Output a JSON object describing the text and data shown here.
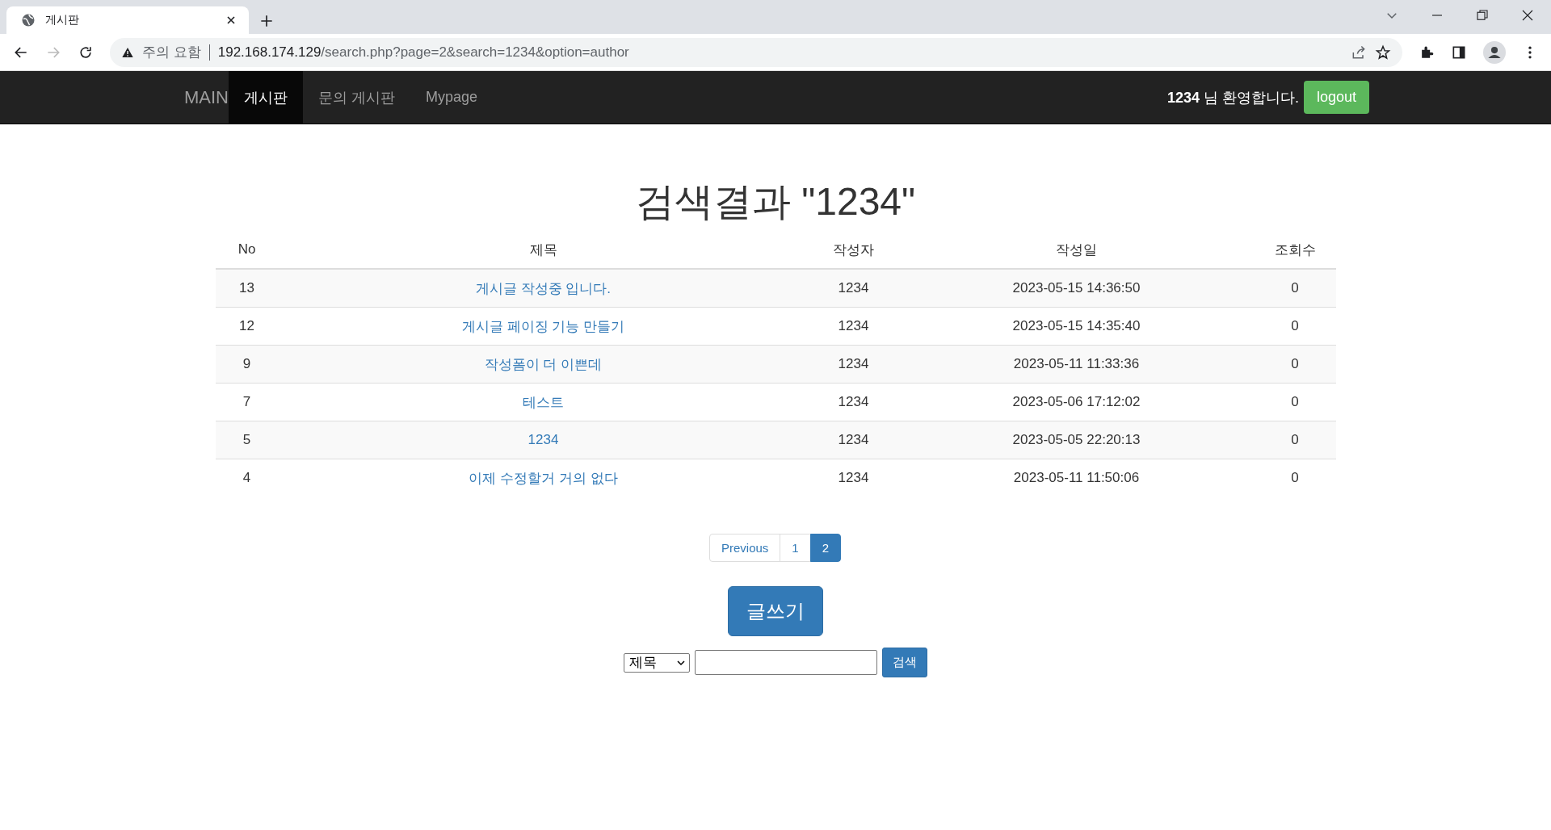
{
  "browser": {
    "tab_title": "게시판",
    "security_label": "주의 요함",
    "url_host": "192.168.174.129",
    "url_path": "/search.php?page=2&search=1234&option=author"
  },
  "navbar": {
    "brand": "MAIN",
    "items": [
      {
        "label": "게시판",
        "selected": true
      },
      {
        "label": "문의 게시판",
        "selected": false
      },
      {
        "label": "Mypage",
        "selected": false
      }
    ],
    "welcome": "**1234** 님 환영합니다.",
    "logout": "logout"
  },
  "title": "검색결과 \"1234\"",
  "table": {
    "columns": [
      "No",
      "제목",
      "작성자",
      "작성일",
      "조회수"
    ],
    "rows": [
      [
        "13",
        "게시글 작성중 입니다.",
        "1234",
        "2023-05-15 14:36:50",
        "0"
      ],
      [
        "12",
        "게시글 페이징 기능 만들기",
        "1234",
        "2023-05-15 14:35:40",
        "0"
      ],
      [
        "9",
        "작성폼이 더 이쁜데",
        "1234",
        "2023-05-11 11:33:36",
        "0"
      ],
      [
        "7",
        "테스트",
        "1234",
        "2023-05-06 17:12:02",
        "0"
      ],
      [
        "5",
        "1234",
        "1234",
        "2023-05-05 22:20:13",
        "0"
      ],
      [
        "4",
        "이제 수정할거 거의 없다",
        "1234",
        "2023-05-11 11:50:06",
        "0"
      ]
    ]
  },
  "pagination": {
    "previous": "Previous",
    "pages": [
      {
        "label": "1",
        "selected": false
      },
      {
        "label": "2",
        "selected": true
      }
    ]
  },
  "write_button": "글쓰기",
  "search": {
    "option": "제목",
    "button": "검색"
  }
}
